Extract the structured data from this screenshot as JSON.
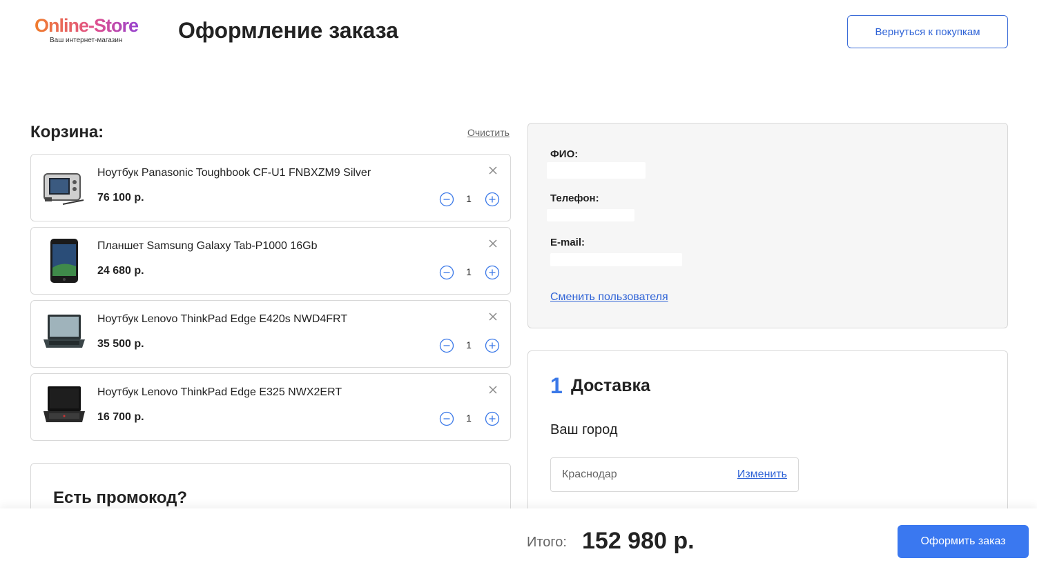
{
  "header": {
    "logo_text": "Online-Store",
    "logo_subtitle": "Ваш интернет-магазин",
    "title": "Оформление заказа",
    "back_button": "Вернуться к покупкам"
  },
  "cart": {
    "title": "Корзина:",
    "clear_label": "Очистить",
    "items": [
      {
        "name": "Ноутбук Panasonic Toughbook CF-U1 FNBXZM9 Silver",
        "price": "76 100 р.",
        "qty": "1",
        "image": "rugged-laptop"
      },
      {
        "name": "Планшет Samsung Galaxy Tab-P1000 16Gb",
        "price": "24 680 р.",
        "qty": "1",
        "image": "tablet"
      },
      {
        "name": "Ноутбук Lenovo ThinkPad Edge E420s NWD4FRT",
        "price": "35 500 р.",
        "qty": "1",
        "image": "laptop"
      },
      {
        "name": "Ноутбук Lenovo ThinkPad Edge E325 NWX2ERT",
        "price": "16 700 р.",
        "qty": "1",
        "image": "laptop-black"
      }
    ]
  },
  "promo": {
    "title": "Есть промокод?"
  },
  "user": {
    "fio_label": "ФИО:",
    "phone_label": "Телефон:",
    "email_label": "E-mail:",
    "change_user": "Сменить пользователя"
  },
  "delivery": {
    "step_number": "1",
    "title": "Доставка",
    "city_label": "Ваш город",
    "city_value": "Краснодар",
    "city_change": "Изменить"
  },
  "footer": {
    "total_label": "Итого:",
    "total_value": "152 980 р.",
    "order_button": "Оформить заказ"
  },
  "colors": {
    "accent": "#3a78f0",
    "link": "#2f63d6",
    "panel_bg": "#f6f6f6",
    "border": "#d8d8d8"
  }
}
